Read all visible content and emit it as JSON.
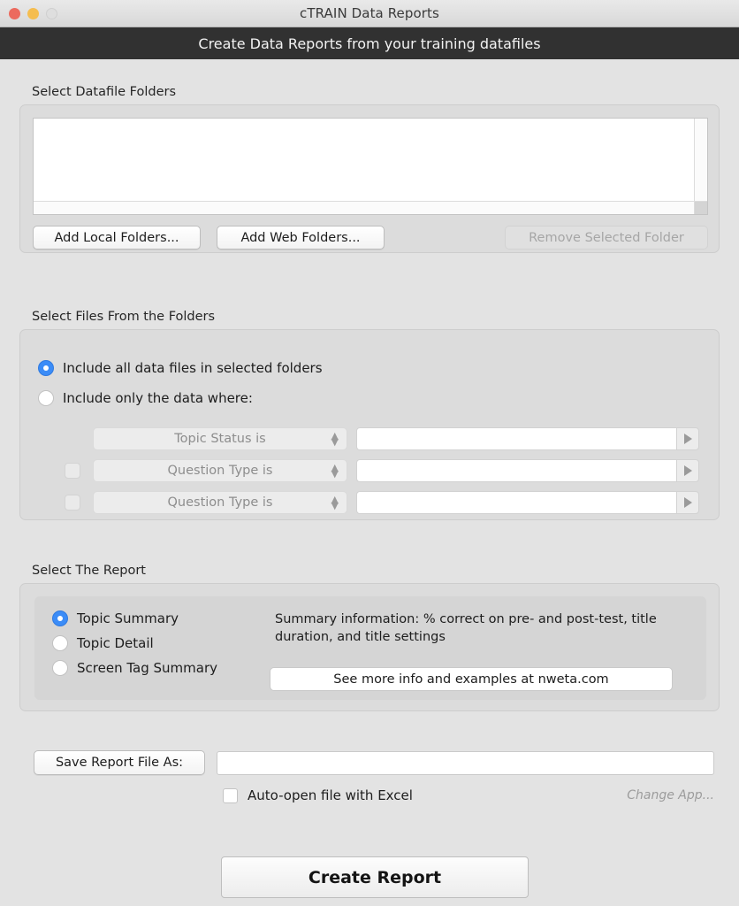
{
  "window": {
    "title": "cTRAIN Data Reports",
    "banner": "Create Data Reports from your training datafiles",
    "traffic_lights": {
      "close": "close-button",
      "minimize": "minimize-button",
      "zoom": "zoom-button"
    },
    "colors": {
      "background": "#e3e3e3",
      "panel": "#dcdcdc",
      "inner_panel": "#d5d5d5",
      "banner_bg": "#313131",
      "accent_blue": "#3b8cf7",
      "close_red": "#ec6a5e",
      "minimize_yellow": "#f5bd4f",
      "zoom_grey": "#dedede",
      "disabled_text": "#a6a6a6"
    }
  },
  "folders_section": {
    "label": "Select Datafile Folders",
    "list_items": [],
    "buttons": {
      "add_local": "Add Local Folders...",
      "add_web": "Add Web Folders...",
      "remove": "Remove Selected Folder",
      "remove_enabled": false
    }
  },
  "files_section": {
    "label": "Select Files From the Folders",
    "radios": [
      {
        "label": "Include all data files in selected folders",
        "selected": true
      },
      {
        "label": "Include only the data where:",
        "selected": false
      }
    ],
    "filters": [
      {
        "has_checkbox": false,
        "checked": false,
        "criterion": "Topic Status is",
        "value": "",
        "enabled": false
      },
      {
        "has_checkbox": true,
        "checked": false,
        "criterion": "Question Type is",
        "value": "",
        "enabled": false
      },
      {
        "has_checkbox": true,
        "checked": false,
        "criterion": "Question Type is",
        "value": "",
        "enabled": false
      }
    ]
  },
  "report_section": {
    "label": "Select The Report",
    "options": [
      {
        "label": "Topic Summary",
        "selected": true
      },
      {
        "label": "Topic Detail",
        "selected": false
      },
      {
        "label": "Screen Tag Summary",
        "selected": false
      }
    ],
    "description": "Summary information: % correct on pre- and post-test, title duration, and title settings",
    "more_info_button": "See more info and examples at nweta.com"
  },
  "save_section": {
    "save_as_button": "Save Report File As:",
    "save_path_value": "",
    "auto_open_label": "Auto-open file with Excel",
    "auto_open_checked": false,
    "change_app_link": "Change App..."
  },
  "footer": {
    "create_report_button": "Create Report"
  }
}
